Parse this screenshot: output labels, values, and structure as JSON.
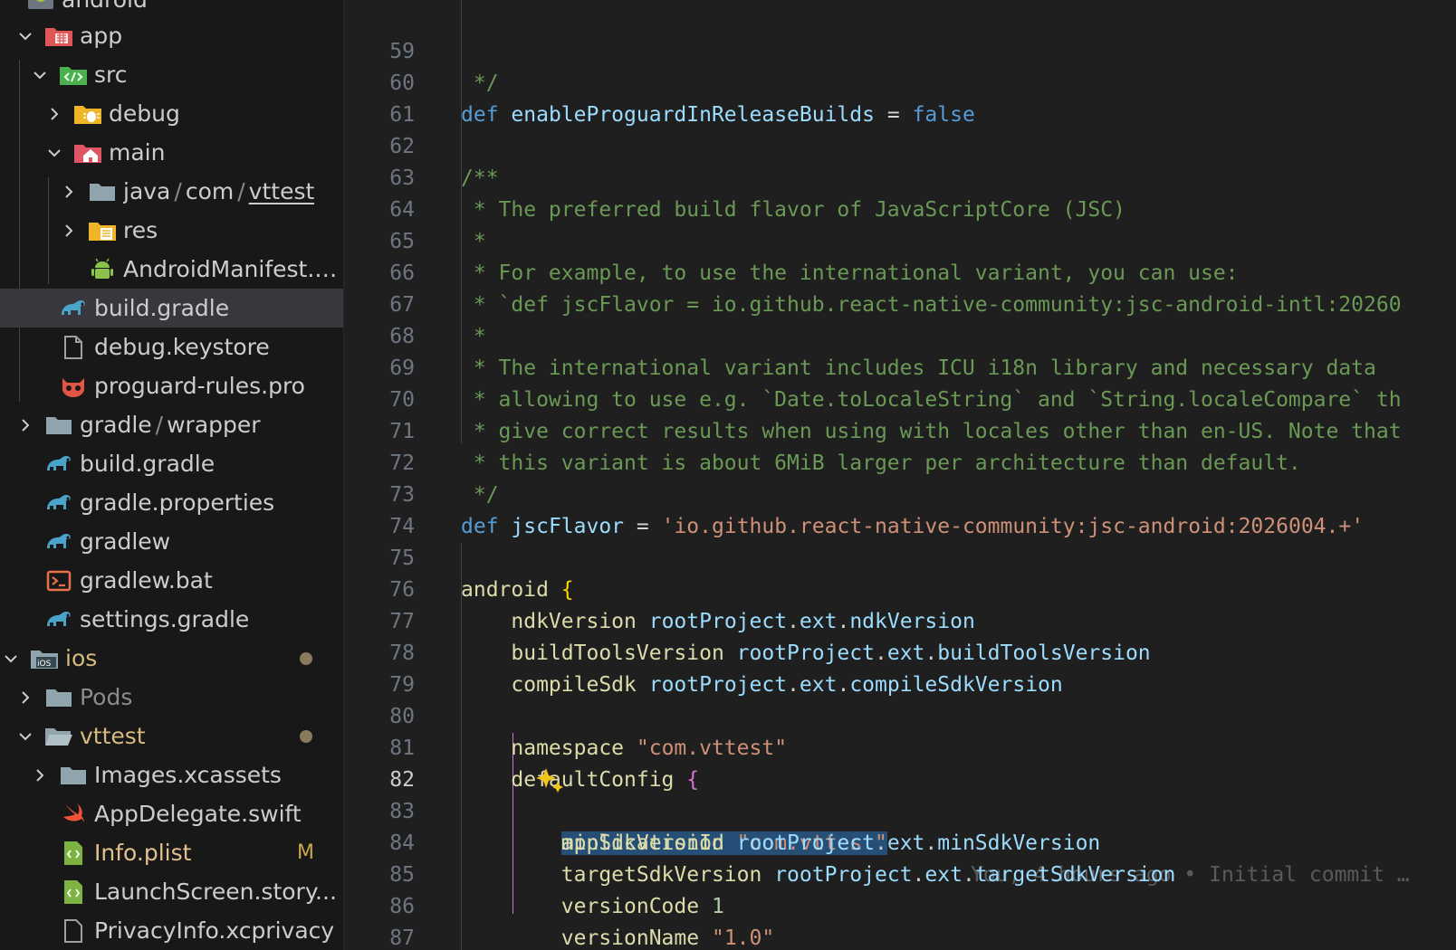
{
  "sidebar": {
    "items": [
      {
        "label": "android",
        "icon": "android-folder-icon"
      },
      {
        "label": "app",
        "icon": "app-folder-icon"
      },
      {
        "label": "src",
        "icon": "src-folder-icon"
      },
      {
        "label": "debug",
        "icon": "debug-folder-icon"
      },
      {
        "label": "main",
        "icon": "main-folder-icon"
      },
      {
        "label_parts": [
          "java",
          "/",
          "com",
          "/",
          "vttest"
        ],
        "icon": "folder-icon"
      },
      {
        "label": "res",
        "icon": "res-folder-icon"
      },
      {
        "label": "AndroidManifest.x...",
        "icon": "android-icon"
      },
      {
        "label": "build.gradle",
        "icon": "gradle-icon"
      },
      {
        "label": "debug.keystore",
        "icon": "file-icon"
      },
      {
        "label": "proguard-rules.pro",
        "icon": "proguard-icon"
      },
      {
        "label_parts": [
          "gradle",
          "/",
          "wrapper"
        ],
        "icon": "folder-icon"
      },
      {
        "label": "build.gradle",
        "icon": "gradle-icon"
      },
      {
        "label": "gradle.properties",
        "icon": "gradle-icon"
      },
      {
        "label": "gradlew",
        "icon": "gradle-icon"
      },
      {
        "label": "gradlew.bat",
        "icon": "terminal-icon"
      },
      {
        "label": "settings.gradle",
        "icon": "gradle-icon"
      },
      {
        "label": "ios",
        "icon": "ios-folder-icon"
      },
      {
        "label": "Pods",
        "icon": "folder-icon"
      },
      {
        "label": "vttest",
        "icon": "folder-open-icon"
      },
      {
        "label": "Images.xcassets",
        "icon": "folder-icon"
      },
      {
        "label": "AppDelegate.swift",
        "icon": "swift-icon"
      },
      {
        "label": "Info.plist",
        "icon": "plist-icon",
        "badge": "M"
      },
      {
        "label": "LaunchScreen.story...",
        "icon": "plist-icon"
      },
      {
        "label": "PrivacyInfo.xcprivacy",
        "icon": "file-icon"
      }
    ]
  },
  "editor": {
    "lines": [
      {
        "n": "59",
        "text": " */"
      },
      {
        "n": "60",
        "text": "def enableProguardInReleaseBuilds = false"
      },
      {
        "n": "61",
        "text": ""
      },
      {
        "n": "62",
        "text": "/**"
      },
      {
        "n": "63",
        "text": " * The preferred build flavor of JavaScriptCore (JSC)"
      },
      {
        "n": "64",
        "text": " *"
      },
      {
        "n": "65",
        "text": " * For example, to use the international variant, you can use:"
      },
      {
        "n": "66",
        "text": " * `def jscFlavor = io.github.react-native-community:jsc-android-intl:20260"
      },
      {
        "n": "67",
        "text": " *"
      },
      {
        "n": "68",
        "text": " * The international variant includes ICU i18n library and necessary data"
      },
      {
        "n": "69",
        "text": " * allowing to use e.g. `Date.toLocaleString` and `String.localeCompare` th"
      },
      {
        "n": "70",
        "text": " * give correct results when using with locales other than en-US. Note that"
      },
      {
        "n": "71",
        "text": " * this variant is about 6MiB larger per architecture than default."
      },
      {
        "n": "72",
        "text": " */"
      },
      {
        "n": "73",
        "text": "def jscFlavor = 'io.github.react-native-community:jsc-android:2026004.+'"
      },
      {
        "n": "74",
        "text": ""
      },
      {
        "n": "75",
        "text": "android {"
      },
      {
        "n": "76",
        "text": "    ndkVersion rootProject.ext.ndkVersion"
      },
      {
        "n": "77",
        "text": "    buildToolsVersion rootProject.ext.buildToolsVersion"
      },
      {
        "n": "78",
        "text": "    compileSdk rootProject.ext.compileSdkVersion"
      },
      {
        "n": "79",
        "text": ""
      },
      {
        "n": "80",
        "text": "    namespace \"com.vttest\""
      },
      {
        "n": "81",
        "text": "    defaultConfig {"
      },
      {
        "n": "82",
        "text": "        applicationId \"com.vttest\""
      },
      {
        "n": "83",
        "text": "        minSdkVersion rootProject.ext.minSdkVersion"
      },
      {
        "n": "84",
        "text": "        targetSdkVersion rootProject.ext.targetSdkVersion"
      },
      {
        "n": "85",
        "text": "        versionCode 1"
      },
      {
        "n": "86",
        "text": "        versionName \"1.0\""
      },
      {
        "n": "87",
        "text": "    }"
      }
    ],
    "active_line": "82",
    "blame": "You, 4 hours ago • Initial commit …"
  },
  "colors": {
    "keyword": "#569cd6",
    "comment": "#6a9955",
    "string": "#ce9178",
    "variable": "#9cdcfe",
    "function": "#dcdcaa",
    "selection": "#264f78",
    "modified": "#c9a84c"
  }
}
